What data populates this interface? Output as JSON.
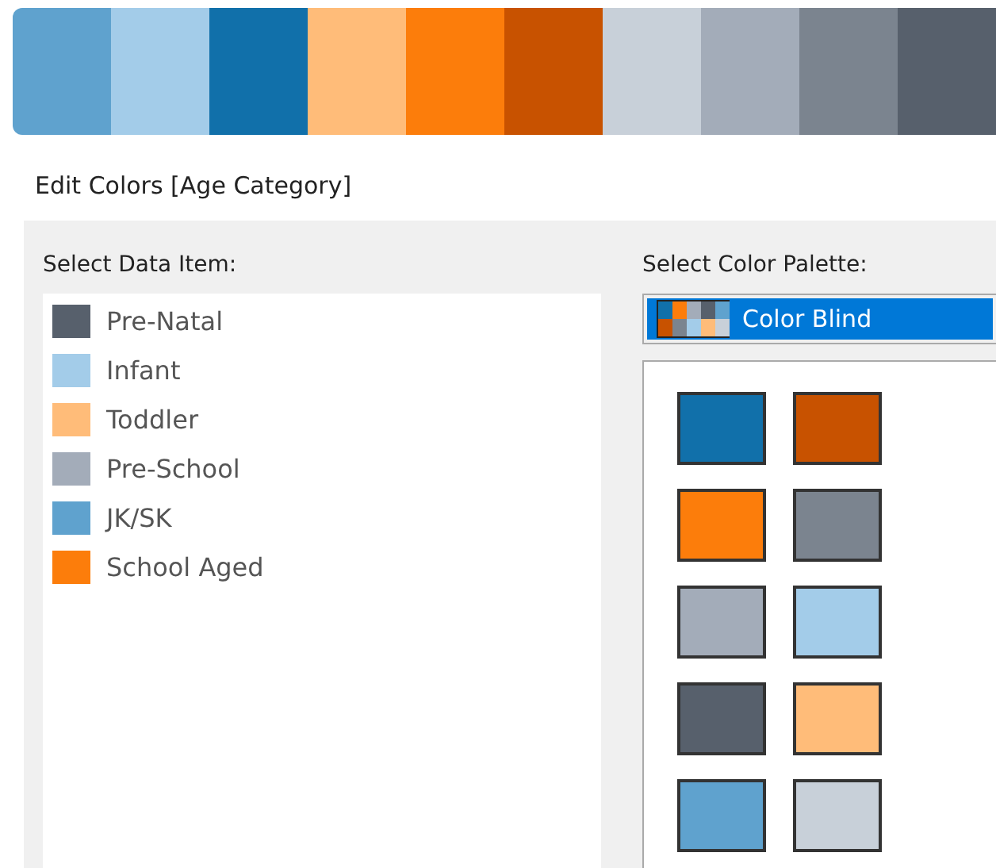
{
  "palette_strip": [
    {
      "color": "#5fa2ce"
    },
    {
      "color": "#a3cce9"
    },
    {
      "color": "#1170aa"
    },
    {
      "color": "#ffbc79"
    },
    {
      "color": "#fc7d0b"
    },
    {
      "color": "#c85200"
    },
    {
      "color": "#c8d0d9"
    },
    {
      "color": "#a3acb9"
    },
    {
      "color": "#7b848f"
    },
    {
      "color": "#57606c"
    }
  ],
  "dialog": {
    "title": "Edit Colors [Age Category]",
    "data_items_label": "Select Data Item:",
    "data_items": [
      {
        "name": "Pre-Natal",
        "color": "#57606c"
      },
      {
        "name": "Infant",
        "color": "#a3cce9"
      },
      {
        "name": "Toddler",
        "color": "#ffbc79"
      },
      {
        "name": "Pre-School",
        "color": "#a3acb9"
      },
      {
        "name": "JK/SK",
        "color": "#5fa2ce"
      },
      {
        "name": "School Aged",
        "color": "#fc7d0b"
      }
    ],
    "palette_label": "Select Color Palette:",
    "palette_dropdown": {
      "value": "Color Blind"
    },
    "swatches": [
      {
        "color": "#1170aa"
      },
      {
        "color": "#c85200"
      },
      {
        "color": "#fc7d0b"
      },
      {
        "color": "#7b848f"
      },
      {
        "color": "#a3acb9"
      },
      {
        "color": "#a3cce9"
      },
      {
        "color": "#57606c"
      },
      {
        "color": "#ffbc79"
      },
      {
        "color": "#5fa2ce"
      },
      {
        "color": "#c8d0d9"
      }
    ]
  }
}
